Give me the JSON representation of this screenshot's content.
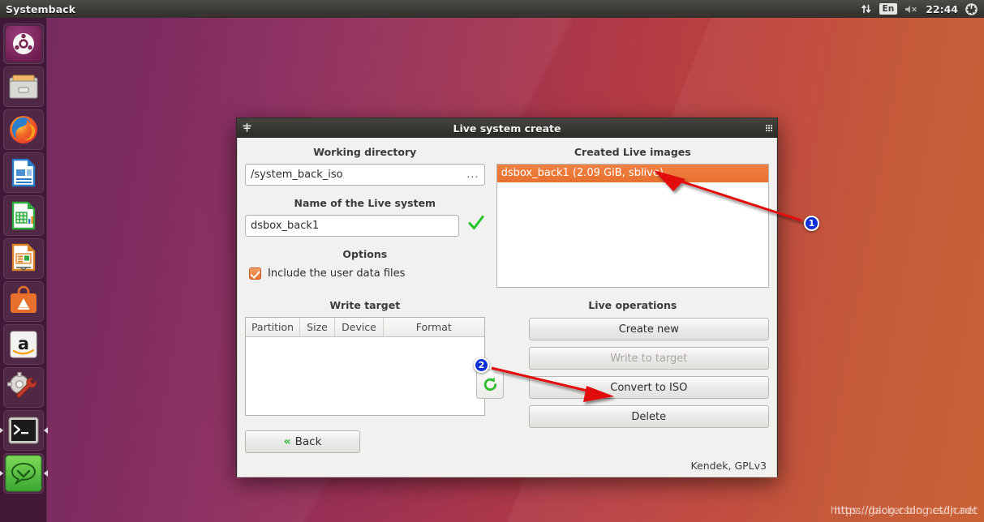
{
  "panel": {
    "app_title": "Systemback",
    "indicators": {
      "network_icon": "network-updown-icon",
      "keyboard_layout": "En",
      "volume_icon": "volume-muted-icon",
      "clock": "22:44",
      "system_icon": "gear-power-icon"
    }
  },
  "launcher": {
    "items": [
      {
        "name": "ubuntu-dash-icon",
        "label": "Ubuntu Dash",
        "running": false
      },
      {
        "name": "files-icon",
        "label": "Files",
        "running": false
      },
      {
        "name": "firefox-icon",
        "label": "Firefox Web Browser",
        "running": false
      },
      {
        "name": "libreoffice-writer-icon",
        "label": "LibreOffice Writer",
        "running": false
      },
      {
        "name": "libreoffice-calc-icon",
        "label": "LibreOffice Calc",
        "running": false
      },
      {
        "name": "libreoffice-impress-icon",
        "label": "LibreOffice Impress",
        "running": false
      },
      {
        "name": "ubuntu-software-icon",
        "label": "Ubuntu Software",
        "running": false
      },
      {
        "name": "amazon-icon",
        "label": "Amazon",
        "running": false
      },
      {
        "name": "system-settings-icon",
        "label": "System Settings",
        "running": false
      },
      {
        "name": "terminal-icon",
        "label": "Terminal",
        "running": true
      },
      {
        "name": "systemback-icon",
        "label": "Systemback",
        "running": true
      }
    ]
  },
  "dialog": {
    "title": "Live system create",
    "titlebar_left_icon": "window-menu-icon",
    "titlebar_right_icon": "grip-dots-icon",
    "working_directory": {
      "label": "Working directory",
      "value": "/system_back_iso",
      "browse_label": "..."
    },
    "live_system_name": {
      "label": "Name of the Live system",
      "value": "dsbox_back1",
      "valid_icon": "green-check-icon"
    },
    "options": {
      "label": "Options",
      "include_user_data": {
        "label": "Include the user data files",
        "checked": true
      }
    },
    "created_live_images": {
      "label": "Created Live images",
      "items": [
        {
          "text": "dsbox_back1 (2.09 GiB, sblive)",
          "selected": true
        }
      ]
    },
    "write_target": {
      "label": "Write target",
      "columns": [
        "Partition",
        "Size",
        "Device",
        "Format"
      ],
      "rows": []
    },
    "live_operations": {
      "label": "Live operations",
      "buttons": [
        {
          "label": "Create new",
          "enabled": true
        },
        {
          "label": "Write to target",
          "enabled": false
        },
        {
          "label": "Convert to ISO",
          "enabled": true
        },
        {
          "label": "Delete",
          "enabled": true
        }
      ],
      "refresh_icon": "refresh-icon"
    },
    "back_button": {
      "label": "Back",
      "icon": "double-chevron-left-icon"
    },
    "credit": "Kendek, GPLv3"
  },
  "annotations": [
    {
      "number": "1",
      "target": "created-live-images-selected-row"
    },
    {
      "number": "2",
      "target": "convert-to-iso-button"
    }
  ],
  "watermark": {
    "line_a": "https://blog.csdn.net/ljcadc",
    "line_b": "https://gacker.blog.csdn.net"
  },
  "colors": {
    "accent_orange": "#e8702d",
    "annotation_red": "#e11010",
    "annotation_blue": "#0b30d8",
    "check_green": "#2fbc2f",
    "panel_dark": "#3c3b38"
  }
}
